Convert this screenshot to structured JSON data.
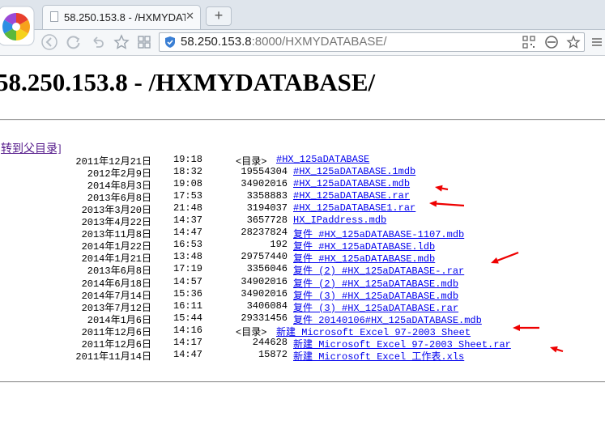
{
  "browser": {
    "tab_title": "58.250.153.8 - /HXMYDAT",
    "tab_close": "✕",
    "new_tab": "+",
    "url_host": "58.250.153.8",
    "url_rest": ":8000/HXMYDATABASE/"
  },
  "page": {
    "heading": "58.250.153.8 - /HXMYDATABASE/",
    "parent_link": "转到父目录]",
    "entries": [
      {
        "date": "2011年12月21日",
        "time": "19:18",
        "size": "<目录>",
        "name": "#HX_125aDATABASE",
        "is_dir": true
      },
      {
        "date": "2012年2月9日",
        "time": "18:32",
        "size": "19554304",
        "name": "#HX_125aDATABASE.1mdb",
        "is_dir": false
      },
      {
        "date": "2014年8月3日",
        "time": "19:08",
        "size": "34902016",
        "name": "#HX_125aDATABASE.mdb",
        "is_dir": false
      },
      {
        "date": "2013年6月8日",
        "time": "17:53",
        "size": "3358883",
        "name": "#HX_125aDATABASE.rar",
        "is_dir": false
      },
      {
        "date": "2013年3月20日",
        "time": "21:48",
        "size": "3194037",
        "name": "#HX_125aDATABASE1.rar",
        "is_dir": false
      },
      {
        "date": "2013年4月22日",
        "time": "14:37",
        "size": "3657728",
        "name": "HX_IPaddress.mdb",
        "is_dir": false
      },
      {
        "date": "2013年11月8日",
        "time": "14:47",
        "size": "28237824",
        "name": "复件 #HX_125aDATABASE-1107.mdb",
        "is_dir": false
      },
      {
        "date": "2014年1月22日",
        "time": "16:53",
        "size": "192",
        "name": "复件 #HX_125aDATABASE.ldb",
        "is_dir": false
      },
      {
        "date": "2014年1月21日",
        "time": "13:48",
        "size": "29757440",
        "name": "复件 #HX_125aDATABASE.mdb",
        "is_dir": false
      },
      {
        "date": "2013年6月8日",
        "time": "17:19",
        "size": "3356046",
        "name": "复件 (2) #HX_125aDATABASE-.rar",
        "is_dir": false
      },
      {
        "date": "2014年6月18日",
        "time": "14:57",
        "size": "34902016",
        "name": "复件 (2) #HX_125aDATABASE.mdb",
        "is_dir": false
      },
      {
        "date": "2014年7月14日",
        "time": "15:36",
        "size": "34902016",
        "name": "复件 (3) #HX_125aDATABASE.mdb",
        "is_dir": false
      },
      {
        "date": "2013年7月12日",
        "time": "16:11",
        "size": "3406084",
        "name": "复件 (3) #HX_125aDATABASE.rar",
        "is_dir": false
      },
      {
        "date": "2014年1月6日",
        "time": "15:44",
        "size": "29331456",
        "name": "复件 20140106#HX_125aDATABASE.mdb",
        "is_dir": false
      },
      {
        "date": "2011年12月6日",
        "time": "14:16",
        "size": "<目录>",
        "name": "新建 Microsoft Excel 97-2003 Sheet",
        "is_dir": true
      },
      {
        "date": "2011年12月6日",
        "time": "14:17",
        "size": "244628",
        "name": "新建 Microsoft Excel 97-2003 Sheet.rar",
        "is_dir": false
      },
      {
        "date": "2011年11月14日",
        "time": "14:47",
        "size": "15872",
        "name": "新建 Microsoft Excel 工作表.xls",
        "is_dir": false
      }
    ]
  },
  "annotations": {
    "arrow_color": "#ee0000",
    "arrow_count": 6
  }
}
